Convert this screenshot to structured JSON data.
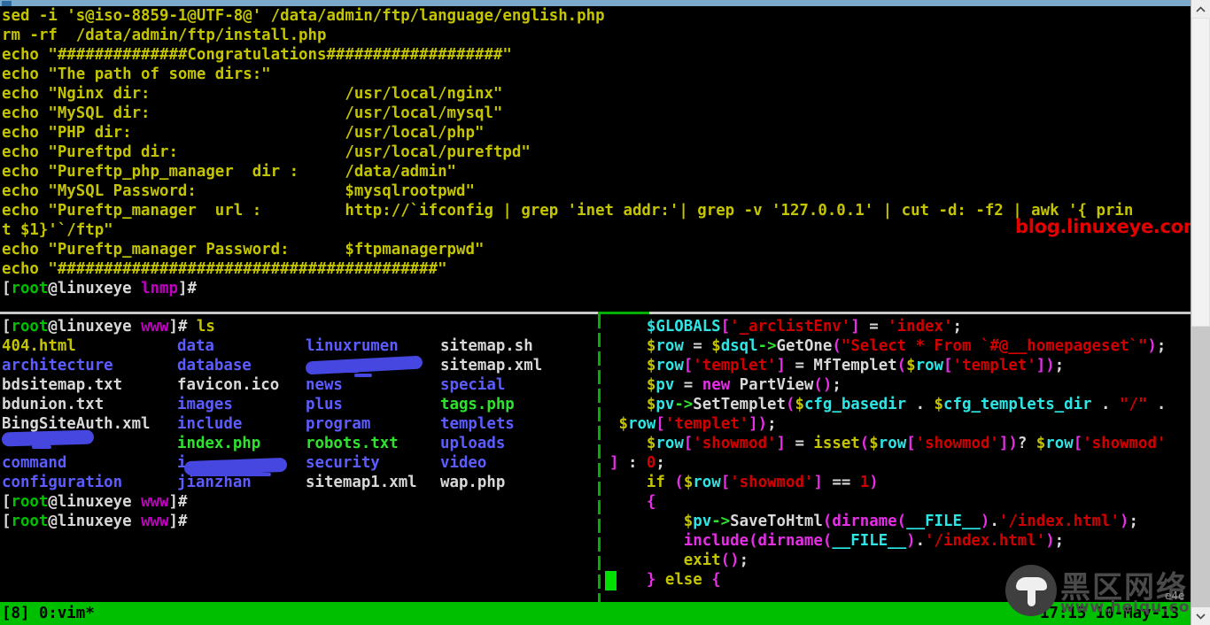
{
  "window": {
    "title_strip_color": "#7aa9cc",
    "background": "#000000"
  },
  "top_pane": {
    "lines": [
      [
        {
          "t": "sed -i 's@iso-8859-1@UTF-8@' /data/admin/ftp/language/english.php",
          "c": "c-yellow"
        }
      ],
      [
        {
          "t": "rm -rf  /data/admin/ftp/install.php",
          "c": "c-yellow"
        }
      ],
      [
        {
          "t": "echo \"##############Congratulations###################\"",
          "c": "c-yellow"
        }
      ],
      [
        {
          "t": "echo \"The path of some dirs:\"",
          "c": "c-yellow"
        }
      ],
      [
        {
          "t": "echo \"Nginx dir:                     /usr/local/nginx\"",
          "c": "c-yellow"
        }
      ],
      [
        {
          "t": "echo \"MySQL dir:                     /usr/local/mysql\"",
          "c": "c-yellow"
        }
      ],
      [
        {
          "t": "echo \"PHP dir:                       /usr/local/php\"",
          "c": "c-yellow"
        }
      ],
      [
        {
          "t": "echo \"Pureftpd dir:                  /usr/local/pureftpd\"",
          "c": "c-yellow"
        }
      ],
      [
        {
          "t": "echo \"Pureftp_php_manager  dir :     /data/admin\"",
          "c": "c-yellow"
        }
      ],
      [
        {
          "t": "echo \"MySQL Password:                $mysqlrootpwd\"",
          "c": "c-yellow"
        }
      ],
      [
        {
          "t": "echo \"Pureftp_manager  url :         http://`ifconfig | grep 'inet addr:'| grep -v '127.0.0.1' | cut -d: -f2 | awk '{ prin",
          "c": "c-yellow"
        }
      ],
      [
        {
          "t": "t $1}'`/ftp\"",
          "c": "c-yellow"
        }
      ],
      [
        {
          "t": "echo \"Pureftp_manager Password:      $ftpmanagerpwd\"",
          "c": "c-yellow"
        }
      ],
      [
        {
          "t": "echo \"#########################################\"",
          "c": "c-yellow"
        }
      ],
      [
        {
          "t": "[",
          "c": "c-white"
        },
        {
          "t": "root",
          "c": "c-green"
        },
        {
          "t": "@linuxeye ",
          "c": "c-white"
        },
        {
          "t": "lnmp",
          "c": "c-magenta"
        },
        {
          "t": "]# ",
          "c": "c-white"
        }
      ]
    ]
  },
  "bottom_left_pane": {
    "prompt_ls": [
      {
        "t": "[",
        "c": "c-white"
      },
      {
        "t": "root",
        "c": "c-green"
      },
      {
        "t": "@linuxeye ",
        "c": "c-white"
      },
      {
        "t": "www",
        "c": "c-magenta"
      },
      {
        "t": "]# ",
        "c": "c-white"
      },
      {
        "t": "ls",
        "c": "c-yellow"
      }
    ],
    "listing_columns": [
      [
        {
          "name": "404.html",
          "color": "c-yellow"
        },
        {
          "name": "architecture",
          "color": "c-bblue"
        },
        {
          "name": "bdsitemap.txt",
          "color": "c-white"
        },
        {
          "name": "bdunion.txt",
          "color": "c-white"
        },
        {
          "name": "BingSiteAuth.xml",
          "color": "c-white"
        },
        {
          "name": "",
          "color": "c-bblue",
          "redacted": true
        },
        {
          "name": "command",
          "color": "c-bblue"
        },
        {
          "name": "configuration",
          "color": "c-bblue"
        }
      ],
      [
        {
          "name": "data",
          "color": "c-bblue"
        },
        {
          "name": "database",
          "color": "c-bblue"
        },
        {
          "name": "favicon.ico",
          "color": "c-white"
        },
        {
          "name": "images",
          "color": "c-bblue"
        },
        {
          "name": "include",
          "color": "c-bblue"
        },
        {
          "name": "index.php",
          "color": "c-bgreen"
        },
        {
          "name": "i",
          "color": "c-bblue",
          "redacted": true
        },
        {
          "name": "jianzhan",
          "color": "c-bblue"
        }
      ],
      [
        {
          "name": "linuxrumen",
          "color": "c-bblue"
        },
        {
          "name": "",
          "color": "c-bblue",
          "redacted": true
        },
        {
          "name": "news",
          "color": "c-bblue"
        },
        {
          "name": "plus",
          "color": "c-bblue"
        },
        {
          "name": "program",
          "color": "c-bblue"
        },
        {
          "name": "robots.txt",
          "color": "c-bgreen"
        },
        {
          "name": "security",
          "color": "c-bblue"
        },
        {
          "name": "sitemap1.xml",
          "color": "c-white"
        }
      ],
      [
        {
          "name": "sitemap.sh",
          "color": "c-white"
        },
        {
          "name": "sitemap.xml",
          "color": "c-white"
        },
        {
          "name": "special",
          "color": "c-bblue"
        },
        {
          "name": "tags.php",
          "color": "c-bgreen"
        },
        {
          "name": "templets",
          "color": "c-bblue"
        },
        {
          "name": "uploads",
          "color": "c-bblue"
        },
        {
          "name": "video",
          "color": "c-bblue"
        },
        {
          "name": "wap.php",
          "color": "c-white"
        }
      ]
    ],
    "trailing_prompts": [
      [
        {
          "t": "[",
          "c": "c-white"
        },
        {
          "t": "root",
          "c": "c-green"
        },
        {
          "t": "@linuxeye ",
          "c": "c-white"
        },
        {
          "t": "www",
          "c": "c-magenta"
        },
        {
          "t": "]# ",
          "c": "c-white"
        }
      ],
      [
        {
          "t": "[",
          "c": "c-white"
        },
        {
          "t": "root",
          "c": "c-green"
        },
        {
          "t": "@linuxeye ",
          "c": "c-white"
        },
        {
          "t": "www",
          "c": "c-magenta"
        },
        {
          "t": "]# ",
          "c": "c-white"
        }
      ]
    ]
  },
  "bottom_right_pane": {
    "editor": "vim",
    "lines": [
      [
        {
          "t": "    ",
          "c": "c-white"
        },
        {
          "t": "$GLOBALS",
          "c": "c-bcyan"
        },
        {
          "t": "[",
          "c": "c-bmagenta"
        },
        {
          "t": "'_arclistEnv'",
          "c": "c-red"
        },
        {
          "t": "]",
          "c": "c-bmagenta"
        },
        {
          "t": " = ",
          "c": "c-white"
        },
        {
          "t": "'index'",
          "c": "c-red"
        },
        {
          "t": ";",
          "c": "c-white"
        }
      ],
      [
        {
          "t": "    ",
          "c": "c-white"
        },
        {
          "t": "$",
          "c": "c-yellow"
        },
        {
          "t": "row",
          "c": "c-bcyan"
        },
        {
          "t": " = ",
          "c": "c-white"
        },
        {
          "t": "$",
          "c": "c-yellow"
        },
        {
          "t": "dsql",
          "c": "c-bcyan"
        },
        {
          "t": "->",
          "c": "c-bgreen"
        },
        {
          "t": "GetOne",
          "c": "c-white"
        },
        {
          "t": "(",
          "c": "c-bmagenta"
        },
        {
          "t": "\"Select * From `#@__homepageset`\"",
          "c": "c-red"
        },
        {
          "t": ")",
          "c": "c-bmagenta"
        },
        {
          "t": ";",
          "c": "c-white"
        }
      ],
      [
        {
          "t": "    ",
          "c": "c-white"
        },
        {
          "t": "$",
          "c": "c-yellow"
        },
        {
          "t": "row",
          "c": "c-bcyan"
        },
        {
          "t": "[",
          "c": "c-bmagenta"
        },
        {
          "t": "'templet'",
          "c": "c-red"
        },
        {
          "t": "]",
          "c": "c-bmagenta"
        },
        {
          "t": " = MfTemplet",
          "c": "c-white"
        },
        {
          "t": "(",
          "c": "c-bmagenta"
        },
        {
          "t": "$",
          "c": "c-yellow"
        },
        {
          "t": "row",
          "c": "c-bcyan"
        },
        {
          "t": "[",
          "c": "c-bmagenta"
        },
        {
          "t": "'templet'",
          "c": "c-red"
        },
        {
          "t": "])",
          "c": "c-bmagenta"
        },
        {
          "t": ";",
          "c": "c-white"
        }
      ],
      [
        {
          "t": "    ",
          "c": "c-white"
        },
        {
          "t": "$",
          "c": "c-yellow"
        },
        {
          "t": "pv",
          "c": "c-bcyan"
        },
        {
          "t": " = ",
          "c": "c-white"
        },
        {
          "t": "new",
          "c": "c-bmagenta"
        },
        {
          "t": " PartView",
          "c": "c-white"
        },
        {
          "t": "()",
          "c": "c-bmagenta"
        },
        {
          "t": ";",
          "c": "c-white"
        }
      ],
      [
        {
          "t": "    ",
          "c": "c-white"
        },
        {
          "t": "$",
          "c": "c-yellow"
        },
        {
          "t": "pv",
          "c": "c-bcyan"
        },
        {
          "t": "->",
          "c": "c-bgreen"
        },
        {
          "t": "SetTemplet",
          "c": "c-white"
        },
        {
          "t": "(",
          "c": "c-bmagenta"
        },
        {
          "t": "$",
          "c": "c-yellow"
        },
        {
          "t": "cfg_basedir",
          "c": "c-bcyan"
        },
        {
          "t": " . ",
          "c": "c-white"
        },
        {
          "t": "$",
          "c": "c-yellow"
        },
        {
          "t": "cfg_templets_dir",
          "c": "c-bcyan"
        },
        {
          "t": " . ",
          "c": "c-white"
        },
        {
          "t": "\"/\"",
          "c": "c-red"
        },
        {
          "t": " .",
          "c": "c-white"
        }
      ],
      [
        {
          "t": " ",
          "c": "c-white"
        },
        {
          "t": "$",
          "c": "c-yellow"
        },
        {
          "t": "row",
          "c": "c-bcyan"
        },
        {
          "t": "[",
          "c": "c-bmagenta"
        },
        {
          "t": "'templet'",
          "c": "c-red"
        },
        {
          "t": "])",
          "c": "c-bmagenta"
        },
        {
          "t": ";",
          "c": "c-white"
        }
      ],
      [
        {
          "t": "    ",
          "c": "c-white"
        },
        {
          "t": "$",
          "c": "c-yellow"
        },
        {
          "t": "row",
          "c": "c-bcyan"
        },
        {
          "t": "[",
          "c": "c-bmagenta"
        },
        {
          "t": "'showmod'",
          "c": "c-red"
        },
        {
          "t": "]",
          "c": "c-bmagenta"
        },
        {
          "t": " = ",
          "c": "c-white"
        },
        {
          "t": "isset",
          "c": "c-yellow"
        },
        {
          "t": "(",
          "c": "c-bmagenta"
        },
        {
          "t": "$",
          "c": "c-yellow"
        },
        {
          "t": "row",
          "c": "c-bcyan"
        },
        {
          "t": "[",
          "c": "c-bmagenta"
        },
        {
          "t": "'showmod'",
          "c": "c-red"
        },
        {
          "t": "])",
          "c": "c-bmagenta"
        },
        {
          "t": "? ",
          "c": "c-white"
        },
        {
          "t": "$",
          "c": "c-yellow"
        },
        {
          "t": "row",
          "c": "c-bcyan"
        },
        {
          "t": "[",
          "c": "c-bmagenta"
        },
        {
          "t": "'showmod'",
          "c": "c-red"
        }
      ],
      [
        {
          "t": "]",
          "c": "c-bmagenta"
        },
        {
          "t": " : ",
          "c": "c-white"
        },
        {
          "t": "0",
          "c": "c-red"
        },
        {
          "t": ";",
          "c": "c-white"
        }
      ],
      [
        {
          "t": "    ",
          "c": "c-white"
        },
        {
          "t": "if",
          "c": "c-yellow"
        },
        {
          "t": " ",
          "c": "c-white"
        },
        {
          "t": "(",
          "c": "c-bmagenta"
        },
        {
          "t": "$",
          "c": "c-yellow"
        },
        {
          "t": "row",
          "c": "c-bcyan"
        },
        {
          "t": "[",
          "c": "c-bmagenta"
        },
        {
          "t": "'showmod'",
          "c": "c-red"
        },
        {
          "t": "]",
          "c": "c-bmagenta"
        },
        {
          "t": " == ",
          "c": "c-white"
        },
        {
          "t": "1",
          "c": "c-red"
        },
        {
          "t": ")",
          "c": "c-bmagenta"
        }
      ],
      [
        {
          "t": "    ",
          "c": "c-white"
        },
        {
          "t": "{",
          "c": "c-bmagenta"
        }
      ],
      [
        {
          "t": "        ",
          "c": "c-white"
        },
        {
          "t": "$",
          "c": "c-yellow"
        },
        {
          "t": "pv",
          "c": "c-bcyan"
        },
        {
          "t": "->",
          "c": "c-bgreen"
        },
        {
          "t": "SaveToHtml",
          "c": "c-white"
        },
        {
          "t": "(",
          "c": "c-bmagenta"
        },
        {
          "t": "dirname",
          "c": "c-bmagenta"
        },
        {
          "t": "(",
          "c": "c-bmagenta"
        },
        {
          "t": "__FILE__",
          "c": "c-bcyan"
        },
        {
          "t": ")",
          "c": "c-bmagenta"
        },
        {
          "t": ".",
          "c": "c-white"
        },
        {
          "t": "'/index.html'",
          "c": "c-red"
        },
        {
          "t": ")",
          "c": "c-bmagenta"
        },
        {
          "t": ";",
          "c": "c-white"
        }
      ],
      [
        {
          "t": "        ",
          "c": "c-white"
        },
        {
          "t": "include",
          "c": "c-bmagenta"
        },
        {
          "t": "(",
          "c": "c-bmagenta"
        },
        {
          "t": "dirname",
          "c": "c-bmagenta"
        },
        {
          "t": "(",
          "c": "c-bmagenta"
        },
        {
          "t": "__FILE__",
          "c": "c-bcyan"
        },
        {
          "t": ")",
          "c": "c-bmagenta"
        },
        {
          "t": ".",
          "c": "c-white"
        },
        {
          "t": "'/index.html'",
          "c": "c-red"
        },
        {
          "t": ")",
          "c": "c-bmagenta"
        },
        {
          "t": ";",
          "c": "c-white"
        }
      ],
      [
        {
          "t": "        ",
          "c": "c-white"
        },
        {
          "t": "exit",
          "c": "c-yellow"
        },
        {
          "t": "()",
          "c": "c-bmagenta"
        },
        {
          "t": ";",
          "c": "c-white"
        }
      ],
      [
        {
          "t": "    ",
          "c": "c-white"
        },
        {
          "t": "}",
          "c": "c-bmagenta"
        },
        {
          "t": " ",
          "c": "c-white"
        },
        {
          "t": "else",
          "c": "c-yellow"
        },
        {
          "t": " ",
          "c": "c-white"
        },
        {
          "t": "{",
          "c": "c-bmagenta"
        }
      ]
    ]
  },
  "status_bar": {
    "left": "[8] 0:vim*",
    "right": "17:15 10-May-13",
    "background": "#00bf00",
    "foreground": "#000000"
  },
  "watermarks": {
    "blog": "blog.linuxeye.com",
    "blog_color": "#e50000",
    "site_cn": "黑区网络",
    "site_url": "www.heiqu.com",
    "site_tiny": "e4e"
  },
  "scrollbar": {
    "up_icon": "chevron-up-icon",
    "down_icon": "chevron-down-icon"
  }
}
